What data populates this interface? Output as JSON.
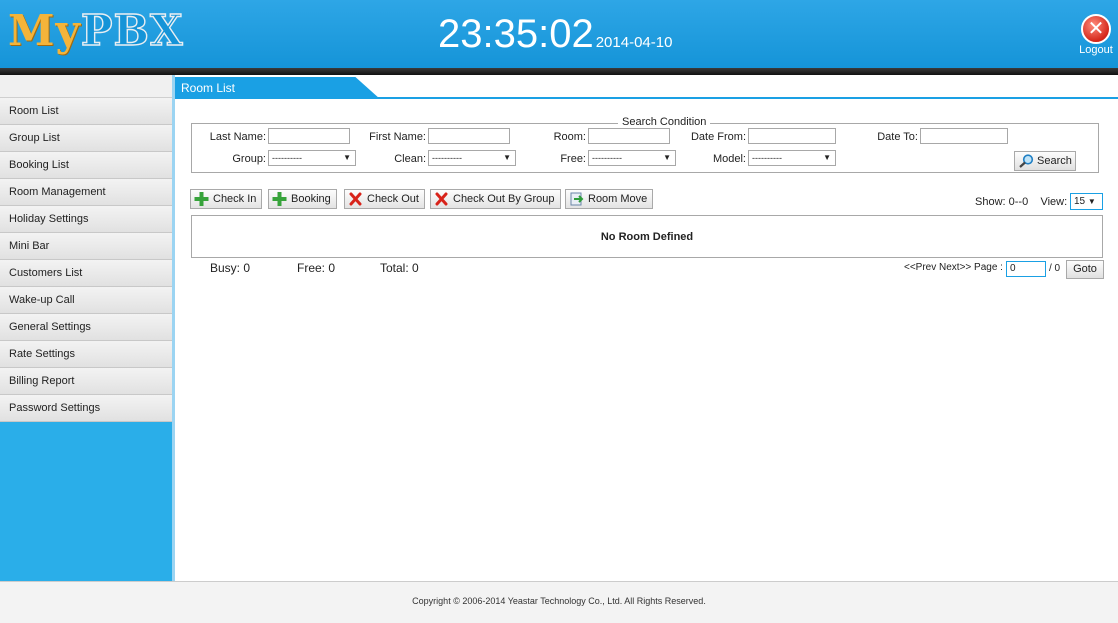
{
  "header": {
    "logo_my": "My",
    "logo_pbx": "PBX",
    "time": "23:35:02",
    "date": "2014-04-10",
    "logout_label": "Logout",
    "accent": "#1aa0e4"
  },
  "sidebar": {
    "items": [
      {
        "label": "Room List"
      },
      {
        "label": "Group List"
      },
      {
        "label": "Booking List"
      },
      {
        "label": "Room Management"
      },
      {
        "label": "Holiday Settings"
      },
      {
        "label": "Mini Bar"
      },
      {
        "label": "Customers List"
      },
      {
        "label": "Wake-up Call"
      },
      {
        "label": "General Settings"
      },
      {
        "label": "Rate Settings"
      },
      {
        "label": "Billing Report"
      },
      {
        "label": "Password Settings"
      }
    ]
  },
  "main": {
    "tab_title": "Room List",
    "search": {
      "legend": "Search Condition",
      "last_name_label": "Last Name:",
      "last_name_value": "",
      "first_name_label": "First Name:",
      "first_name_value": "",
      "room_label": "Room:",
      "room_value": "",
      "date_from_label": "Date From:",
      "date_from_value": "",
      "date_to_label": "Date To:",
      "date_to_value": "",
      "group_label": "Group:",
      "group_value": "----------",
      "clean_label": "Clean:",
      "clean_value": "----------",
      "free_label": "Free:",
      "free_value": "----------",
      "model_label": "Model:",
      "model_value": "----------",
      "search_button": "Search"
    },
    "toolbar": {
      "check_in": "Check In",
      "booking": "Booking",
      "check_out": "Check Out",
      "check_out_group": "Check Out By Group",
      "room_move": "Room Move",
      "show_info": "Show: 0--0",
      "view_label": "View:",
      "view_value": "15"
    },
    "table": {
      "empty_message": "No Room Defined"
    },
    "summary": {
      "busy": "Busy: 0",
      "free": "Free: 0",
      "total": "Total: 0"
    },
    "pager": {
      "prev_next": "<<Prev Next>> Page :",
      "page_value": "0",
      "total_pages": "/ 0",
      "goto": "Goto"
    }
  },
  "footer": {
    "copyright": "Copyright © 2006-2014 Yeastar Technology Co., Ltd. All Rights Reserved."
  }
}
